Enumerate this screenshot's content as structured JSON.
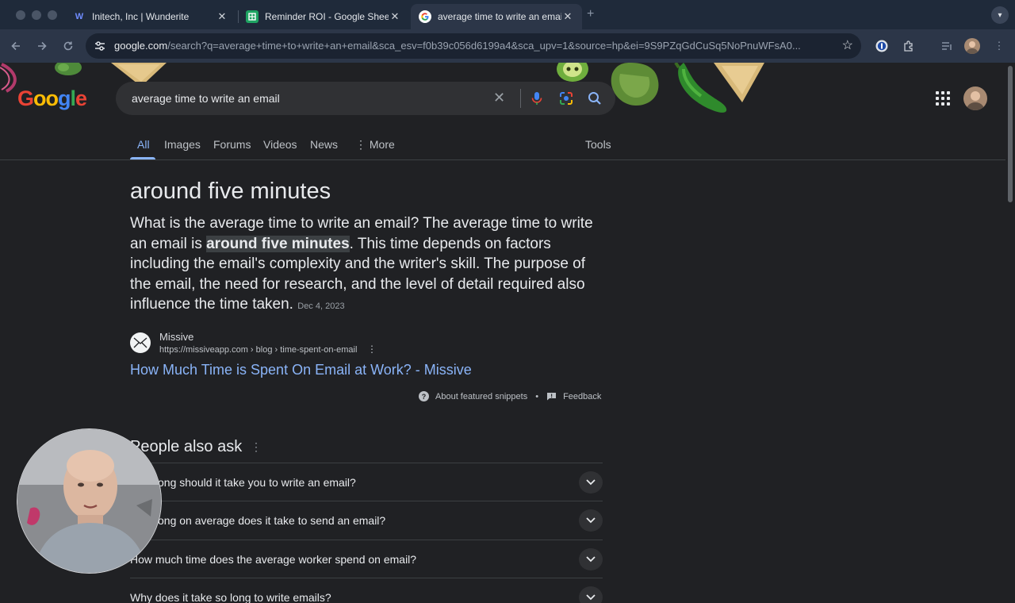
{
  "browser": {
    "tabs": [
      {
        "title": "Initech, Inc | Wunderite",
        "favicon": "wunderite-icon"
      },
      {
        "title": "Reminder ROI - Google Sheets",
        "favicon": "sheets-icon"
      },
      {
        "title": "average time to write an email",
        "favicon": "google-icon",
        "active": true
      }
    ],
    "close_glyph": "✕",
    "new_tab_glyph": "+",
    "url_host": "google.com",
    "url_path": "/search?q=average+time+to+write+an+email&sca_esv=f0b39c056d6199a4&sca_upv=1&source=hp&ei=9S9PZqGdCuSq5NoPnuWFsA0..."
  },
  "search": {
    "logo": "Google",
    "query": "average time to write an email"
  },
  "search_tabs": [
    "All",
    "Images",
    "Forums",
    "Videos",
    "News",
    "More"
  ],
  "tools_label": "Tools",
  "featured": {
    "answer": "around five minutes",
    "snippet_before": "What is the average time to write an email? The average time to write an email is ",
    "snippet_highlight": "around five minutes",
    "snippet_after": ". This time depends on factors including the email's complexity and the writer's skill. The purpose of the email, the need for research, and the level of detail required also influence the time taken.",
    "date": "Dec 4, 2023",
    "source_name": "Missive",
    "source_url": "https://missiveapp.com › blog › time-spent-on-email",
    "link_title": "How Much Time is Spent On Email at Work? - Missive",
    "about_label": "About featured snippets",
    "bullet": "•",
    "feedback_label": "Feedback"
  },
  "people_also_ask": {
    "title": "People also ask",
    "questions": [
      "How long should it take you to write an email?",
      "How long on average does it take to send an email?",
      "How much time does the average worker spend on email?",
      "Why does it take so long to write emails?"
    ]
  },
  "colors": {
    "link": "#8ab4f8",
    "background": "#202124",
    "surface": "#303134"
  }
}
